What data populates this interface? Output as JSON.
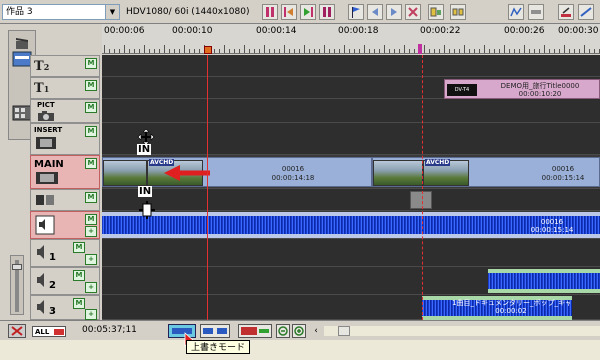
{
  "toolbar": {
    "project_name": "作品 3",
    "format": "HDV1080/ 60i (1440x1080)"
  },
  "ruler": {
    "timecodes": [
      "00:00:06",
      "00:00:10",
      "00:00:14",
      "00:00:18",
      "00:00:22",
      "00:00:26",
      "00:00:30"
    ]
  },
  "tracks": {
    "t2": {
      "name": "T",
      "sub": "2",
      "badge": "M"
    },
    "t1": {
      "name": "T",
      "sub": "1",
      "badge": "M"
    },
    "pict": {
      "name": "PICT",
      "badge": "M"
    },
    "insert": {
      "name": "INSERT",
      "badge": "M"
    },
    "main": {
      "name": "MAIN",
      "badge": "M"
    },
    "audio_main": {
      "badge": "M"
    },
    "a1": {
      "sub": "1",
      "badge": "M"
    },
    "a2": {
      "sub": "2",
      "badge": "M"
    },
    "a3": {
      "sub": "3",
      "badge": "M"
    }
  },
  "clips": {
    "title_clip": {
      "label1": "DEMO用_旅行Title0000",
      "label2": "00:00:10:20",
      "chip": "DV-T4"
    },
    "video1": {
      "label1": "00016",
      "label2": "00:00:14:18",
      "badge": "AVCHD"
    },
    "video2": {
      "label1": "00016",
      "label2": "00:00:15:14",
      "badge": "AVCHD"
    },
    "audio_main": {
      "label1": "00016",
      "label2": "00:00:15:14"
    },
    "audio3": {
      "label1": "1曲目_ドキュメンタリー_ポップ_キャンバス.wav",
      "label2": "00:00:02"
    }
  },
  "markers": {
    "in_label": "IN"
  },
  "bottom": {
    "all_label": "ALL",
    "timecode": "00:05:37;11"
  },
  "tooltip": {
    "text": "上書きモード"
  },
  "colors": {
    "playhead": "#e03030",
    "main_track": "#e8b4b4",
    "video_clip": "#9ab0d8",
    "audio_wave": "#1a3acc"
  }
}
